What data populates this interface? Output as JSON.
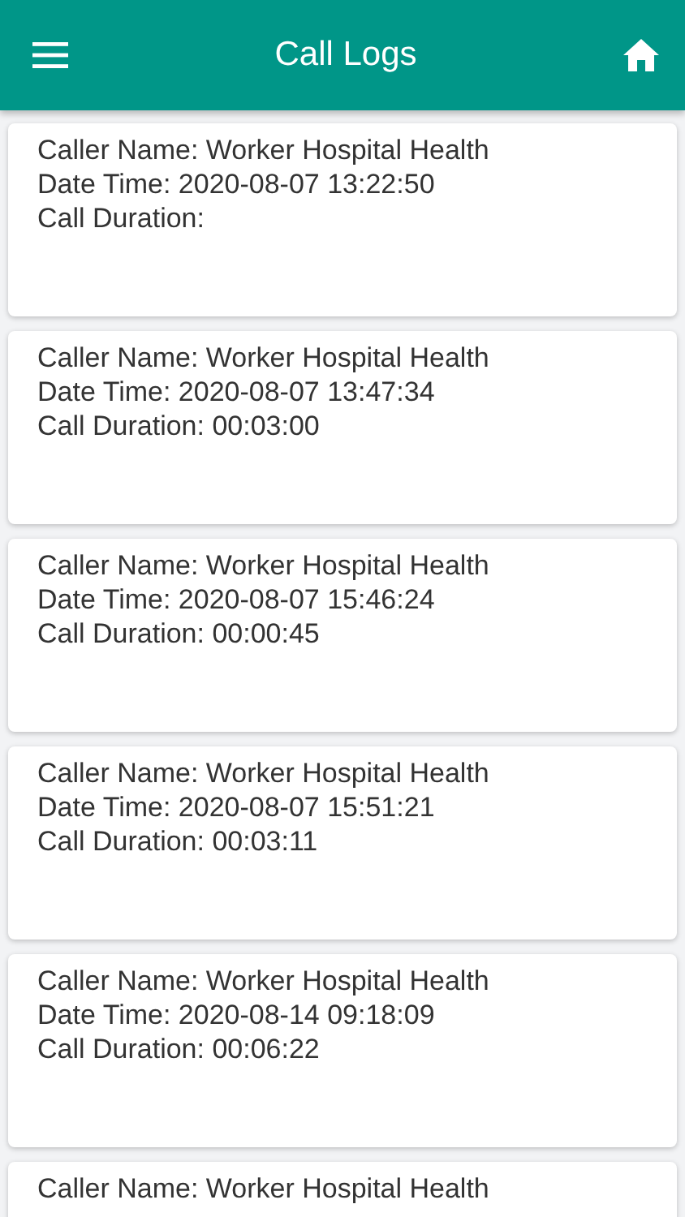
{
  "header": {
    "title": "Call Logs"
  },
  "logs": [
    {
      "lines": [
        "Caller Name: Worker Hospital Health",
        "Date Time: 2020-08-07 13:22:50",
        "Call Duration:"
      ]
    },
    {
      "lines": [
        "Caller Name: Worker Hospital Health",
        "Date Time: 2020-08-07 13:47:34",
        "Call Duration: 00:03:00"
      ]
    },
    {
      "lines": [
        "Caller Name: Worker Hospital Health",
        "Date Time: 2020-08-07 15:46:24",
        "Call Duration: 00:00:45"
      ]
    },
    {
      "lines": [
        "Caller Name: Worker Hospital Health",
        "Date Time: 2020-08-07 15:51:21",
        "Call Duration: 00:03:11"
      ]
    },
    {
      "lines": [
        "Caller Name: Worker Hospital Health",
        "Date Time: 2020-08-14 09:18:09",
        "Call Duration: 00:06:22"
      ]
    },
    {
      "lines": [
        "Caller Name: Worker Hospital Health"
      ]
    }
  ]
}
